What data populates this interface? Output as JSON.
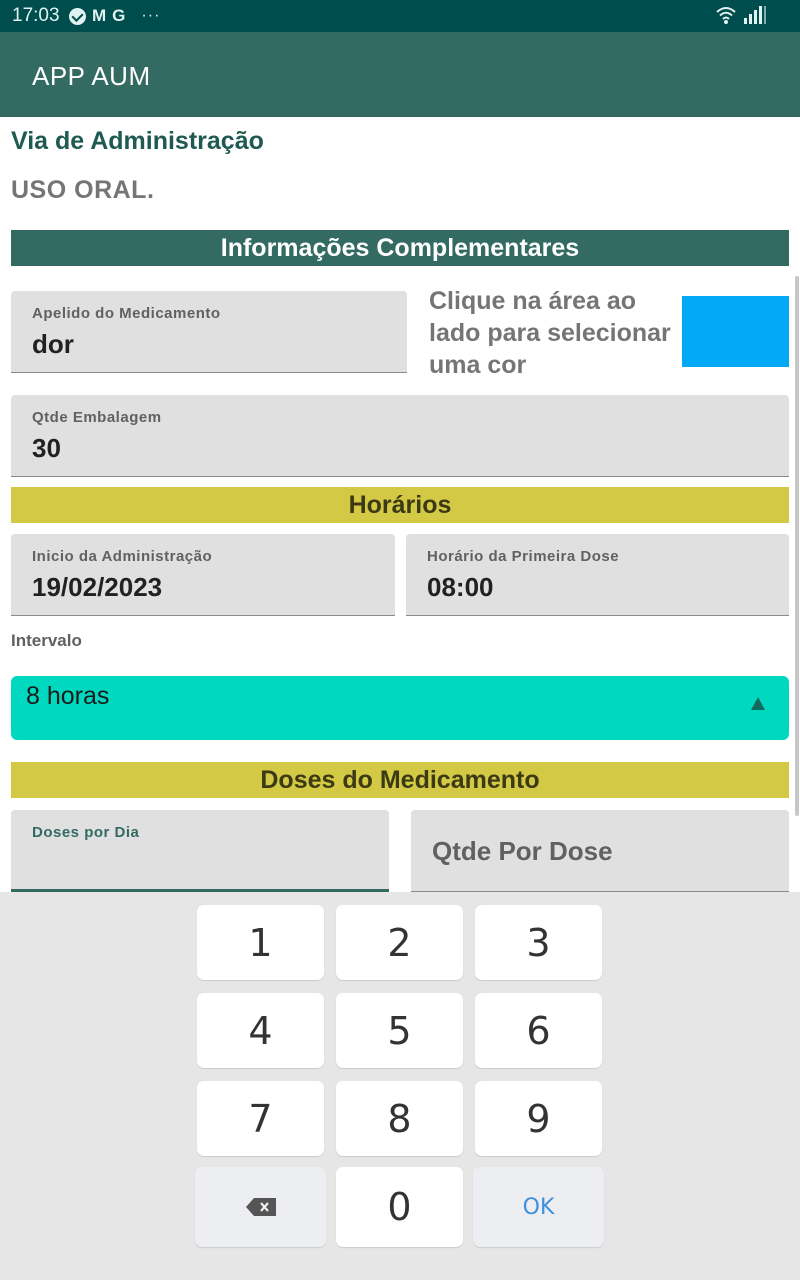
{
  "status_bar": {
    "time": "17:03",
    "icons": [
      "check-circle-icon",
      "gmail-icon",
      "google-icon",
      "more-dots-icon",
      "wifi-icon",
      "signal-icon"
    ],
    "gmail_glyph": "M",
    "google_glyph": "G",
    "dots": "···"
  },
  "app_bar": {
    "title": "APP AUM"
  },
  "route": {
    "title": "Via de Administração",
    "value": "USO ORAL."
  },
  "complementary": {
    "heading": "Informações Complementares",
    "nickname": {
      "label": "Apelido do Medicamento",
      "value": "dor"
    },
    "color_hint": "Clique na área ao lado para selecionar uma cor",
    "color_value": "#03a9f4",
    "package_qty": {
      "label": "Qtde Embalagem",
      "value": "30"
    }
  },
  "schedule": {
    "heading": "Horários",
    "start": {
      "label": "Inicio da Administração",
      "value": "19/02/2023"
    },
    "first_dose": {
      "label": "Horário da Primeira Dose",
      "value": "08:00"
    },
    "interval_label": "Intervalo",
    "interval_value": "8 horas"
  },
  "doses": {
    "heading": "Doses do Medicamento",
    "per_day": {
      "label": "Doses por Dia",
      "value": ""
    },
    "per_dose": {
      "placeholder": "Qtde Por Dose"
    }
  },
  "keyboard": {
    "keys": [
      "1",
      "2",
      "3",
      "4",
      "5",
      "6",
      "7",
      "8",
      "9",
      "0"
    ],
    "ok": "OK",
    "backspace_icon": "backspace-icon"
  },
  "colors": {
    "app_bar": "#336b62",
    "status_bar": "#004d4d",
    "section_yellow": "#d4c945",
    "spinner": "#00d9c0"
  }
}
